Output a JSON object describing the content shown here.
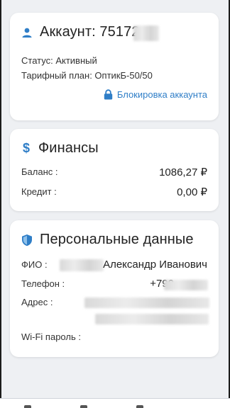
{
  "account": {
    "title_prefix": "Аккаунт: ",
    "number_visible": "75172",
    "status": "Статус: Активный",
    "tariff": "Тарифный план: ОптикБ-50/50",
    "lock_link": "Блокировка аккаунта",
    "icon": "user-icon",
    "accent": "#2f7ec7"
  },
  "finance": {
    "title": "Финансы",
    "icon": "dollar-icon",
    "balance_label": "Баланс :",
    "balance_value": "1086,27 ₽",
    "credit_label": "Кредит :",
    "credit_value": "0,00 ₽"
  },
  "personal": {
    "title": "Персональные данные",
    "icon": "shield-icon",
    "name_label": "ФИО :",
    "name_value": "Александр Иванович",
    "phone_label": "Телефон :",
    "phone_value": "+790",
    "address_label": "Адрес :",
    "wifi_label": "Wi-Fi пароль :"
  }
}
